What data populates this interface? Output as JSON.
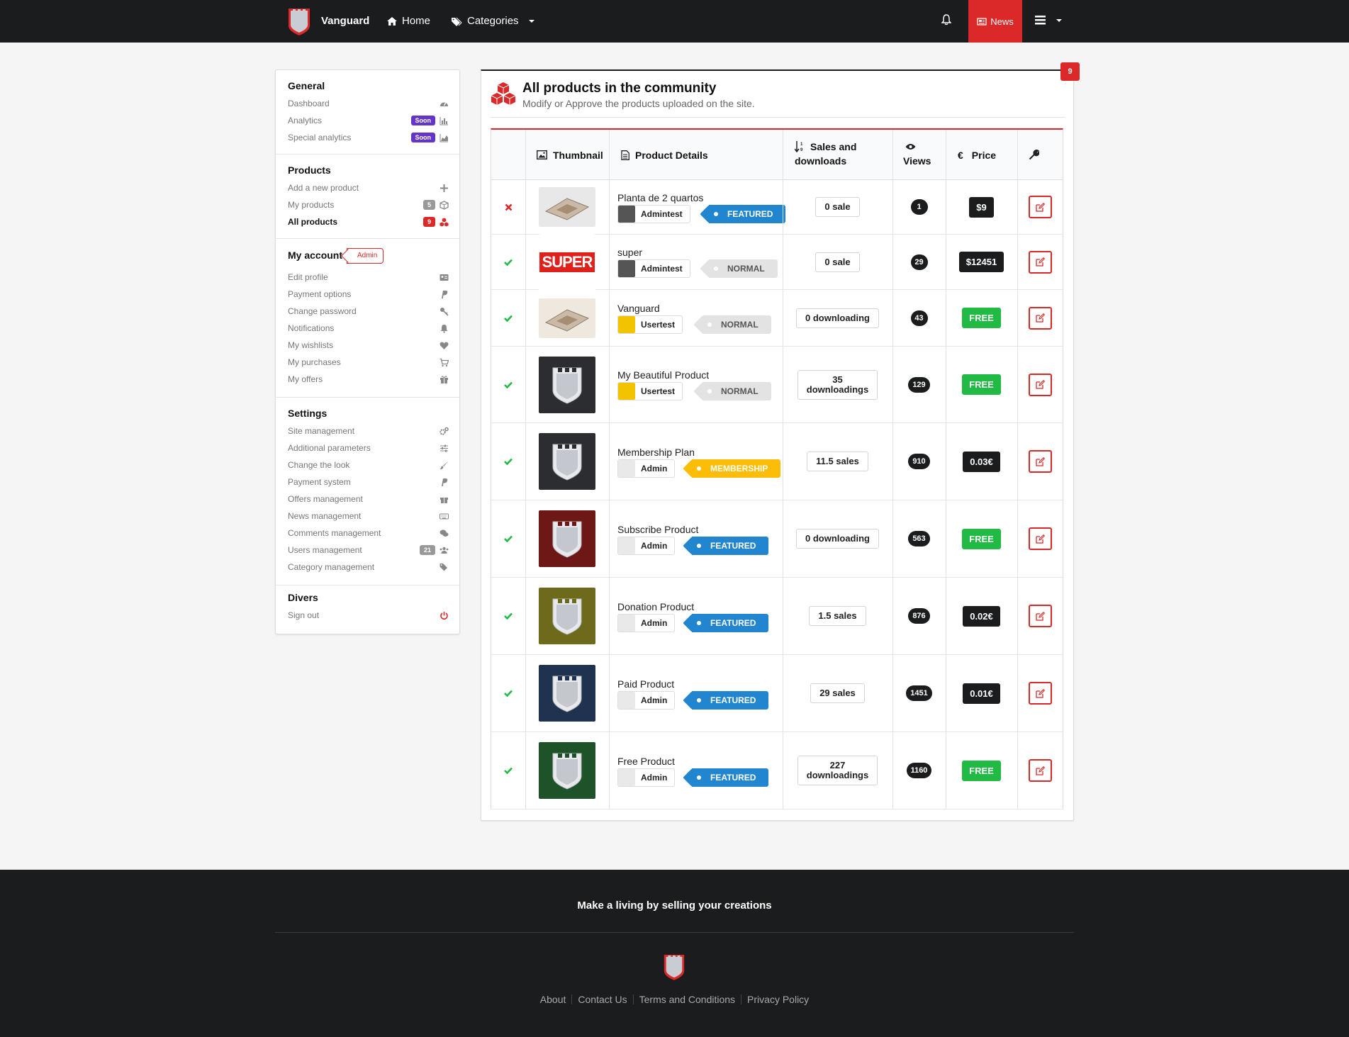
{
  "nav": {
    "brand": "Vanguard",
    "home": "Home",
    "categories": "Categories",
    "news": "News"
  },
  "sidebar": {
    "general": {
      "title": "General",
      "items": [
        {
          "label": "Dashboard",
          "icon": "dashboard-icon"
        },
        {
          "label": "Analytics",
          "badge": "Soon",
          "icon": "bar-chart-icon"
        },
        {
          "label": "Special analytics",
          "badge": "Soon",
          "icon": "area-chart-icon"
        }
      ]
    },
    "products": {
      "title": "Products",
      "items": [
        {
          "label": "Add a new product",
          "icon": "plus-icon"
        },
        {
          "label": "My products",
          "badge": "5",
          "icon": "cube-icon"
        },
        {
          "label": "All products",
          "badge": "9",
          "icon": "cubes-icon"
        }
      ]
    },
    "account": {
      "title": "My account",
      "role_tag": "Admin",
      "items": [
        {
          "label": "Edit profile",
          "icon": "id-card-icon"
        },
        {
          "label": "Payment options",
          "icon": "paypal-icon"
        },
        {
          "label": "Change password",
          "icon": "key-icon"
        },
        {
          "label": "Notifications",
          "icon": "bell-icon"
        },
        {
          "label": "My wishlists",
          "icon": "heart-icon"
        },
        {
          "label": "My purchases",
          "icon": "cart-icon"
        },
        {
          "label": "My offers",
          "icon": "gift-icon"
        }
      ]
    },
    "settings": {
      "title": "Settings",
      "items": [
        {
          "label": "Site management",
          "icon": "cogs-icon"
        },
        {
          "label": "Additional parameters",
          "icon": "sliders-icon"
        },
        {
          "label": "Change the look",
          "icon": "paint-brush-icon"
        },
        {
          "label": "Payment system",
          "icon": "paypal-icon"
        },
        {
          "label": "Offers management",
          "icon": "gift-icon"
        },
        {
          "label": "News management",
          "icon": "keyboard-icon"
        },
        {
          "label": "Comments management",
          "icon": "comments-icon"
        },
        {
          "label": "Users management",
          "badge": "21",
          "icon": "users-icon"
        },
        {
          "label": "Category management",
          "icon": "tags-icon"
        }
      ]
    },
    "divers": {
      "title": "Divers",
      "items": [
        {
          "label": "Sign out",
          "icon": "power-icon"
        }
      ]
    }
  },
  "main": {
    "badge": "9",
    "title": "All products in the community",
    "subtitle": "Modify or Approve the products uploaded on the site.",
    "columns": {
      "thumbnail": "Thumbnail",
      "details": "Product Details",
      "sales_line1": "Sales and",
      "sales_line2": "downloads",
      "views": "Views",
      "price": "Price"
    },
    "rows": [
      {
        "status": "rejected",
        "name": "Planta de 2 quartos",
        "user": "Admintest",
        "tag": "FEATURED",
        "sales": [
          "0 sale"
        ],
        "views": "1",
        "price": "$9",
        "price_style": "dark",
        "thumb_color": "#e8e8e8"
      },
      {
        "status": "approved",
        "name": "super",
        "user": "Admintest",
        "tag": "NORMAL",
        "sales": [
          "0 sale"
        ],
        "views": "29",
        "price": "$12451",
        "price_style": "dark",
        "thumb_text": "SUPER"
      },
      {
        "status": "approved",
        "name": "Vanguard",
        "user": "Usertest",
        "tag": "NORMAL",
        "sales": [
          "0 downloading"
        ],
        "views": "43",
        "price": "FREE",
        "price_style": "green",
        "thumb_color": "#efe8df"
      },
      {
        "status": "approved",
        "name": "My Beautiful Product",
        "user": "Usertest",
        "tag": "NORMAL",
        "sales": [
          "35",
          "downloadings"
        ],
        "views": "129",
        "price": "FREE",
        "price_style": "green",
        "thumb_color": "#2b2d31"
      },
      {
        "status": "approved",
        "name": "Membership Plan",
        "user": "Admin",
        "tag": "MEMBERSHIP",
        "sales": [
          "11.5 sales"
        ],
        "views": "910",
        "price": "0.03€",
        "price_style": "dark",
        "thumb_color": "#2b2d31"
      },
      {
        "status": "approved",
        "name": "Subscribe Product",
        "user": "Admin",
        "tag": "FEATURED",
        "sales": [
          "0 downloading"
        ],
        "views": "563",
        "price": "FREE",
        "price_style": "green",
        "thumb_color": "#6e1717"
      },
      {
        "status": "approved",
        "name": "Donation Product",
        "user": "Admin",
        "tag": "FEATURED",
        "sales": [
          "1.5 sales"
        ],
        "views": "876",
        "price": "0.02€",
        "price_style": "dark",
        "thumb_color": "#6d6a1c"
      },
      {
        "status": "approved",
        "name": "Paid Product",
        "user": "Admin",
        "tag": "FEATURED",
        "sales": [
          "29 sales"
        ],
        "views": "1451",
        "price": "0.01€",
        "price_style": "dark",
        "thumb_color": "#1f3350"
      },
      {
        "status": "approved",
        "name": "Free Product",
        "user": "Admin",
        "tag": "FEATURED",
        "sales": [
          "227",
          "downloadings"
        ],
        "views": "1160",
        "price": "FREE",
        "price_style": "green",
        "thumb_color": "#1e5228"
      }
    ]
  },
  "footer": {
    "slogan": "Make a living by selling your creations",
    "links": [
      "About",
      "Contact Us",
      "Terms and Conditions",
      "Privacy Policy"
    ]
  },
  "colors": {
    "accent": "#db2828",
    "dark": "#1b1c1d",
    "green": "#21ba45",
    "blue": "#2185d0",
    "purple": "#6435c9",
    "yellow": "#fbbd08"
  }
}
